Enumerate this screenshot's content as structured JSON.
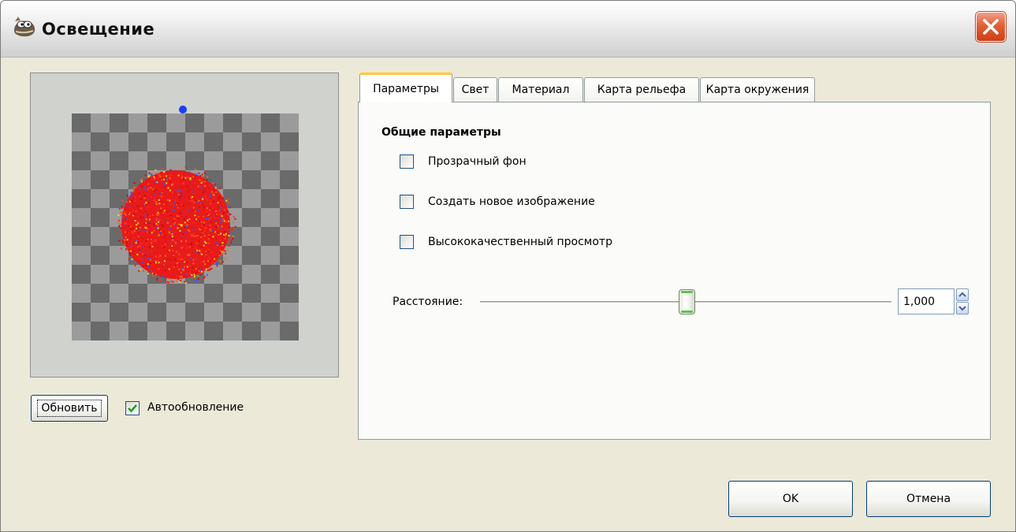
{
  "window": {
    "title": "Освещение",
    "icon": "gimp-wilber-icon",
    "close_icon": "close-icon"
  },
  "preview": {
    "refresh_label": "Обновить",
    "auto_update_label": "Автообновление",
    "auto_update_checked": true
  },
  "tabs": [
    {
      "label": "Параметры",
      "active": true
    },
    {
      "label": "Свет",
      "active": false
    },
    {
      "label": "Материал",
      "active": false
    },
    {
      "label": "Карта рельефа",
      "active": false
    },
    {
      "label": "Карта окружения",
      "active": false
    }
  ],
  "options": {
    "group_title": "Общие параметры",
    "transparent_bg": {
      "label": "Прозрачный фон",
      "checked": false
    },
    "new_image": {
      "label": "Создать новое изображение",
      "checked": false
    },
    "hq_preview": {
      "label": "Высококачественный просмотр",
      "checked": false
    }
  },
  "distance": {
    "label": "Расстояние:",
    "value": "1,000",
    "slider_fraction": 0.5
  },
  "buttons": {
    "ok": "OK",
    "cancel": "Отмена"
  },
  "colors": {
    "sphere": "#e81a1a",
    "light_point": "#1a3cff",
    "check_light": "#9b9b9b",
    "check_dark": "#6a6a6a"
  }
}
